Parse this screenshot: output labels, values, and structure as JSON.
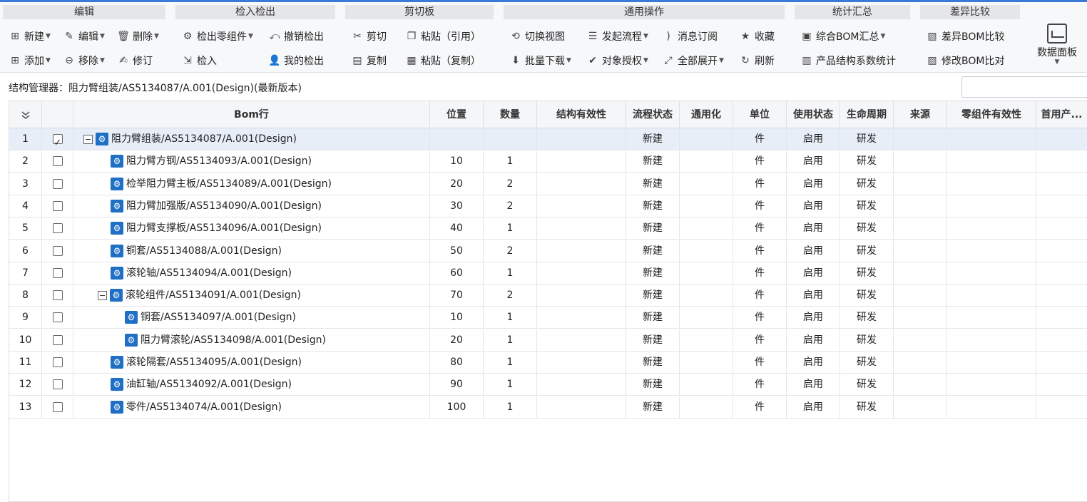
{
  "ribbon": {
    "groups": [
      {
        "title": "编辑"
      },
      {
        "title": "检入检出"
      },
      {
        "title": "剪切板"
      },
      {
        "title": "通用操作"
      },
      {
        "title": "统计汇总"
      },
      {
        "title": "差异比较"
      }
    ],
    "edit": {
      "new": "新建",
      "edit": "编辑",
      "delete": "删除",
      "add": "添加",
      "remove": "移除",
      "revise": "修订"
    },
    "checkinout": {
      "checkout_part": "检出零组件",
      "undo_checkout": "撤销检出",
      "checkin": "检入",
      "my_checkout": "我的检出"
    },
    "clipboard": {
      "cut": "剪切",
      "paste_ref": "粘贴（引用）",
      "copy": "复制",
      "paste_copy": "粘贴（复制）"
    },
    "common": {
      "switch_view": "切换视图",
      "start_flow": "发起流程",
      "subscribe": "消息订阅",
      "favorite": "收藏",
      "batch_download": "批量下载",
      "authorize": "对象授权",
      "expand_all": "全部展开",
      "refresh": "刷新"
    },
    "stats": {
      "bom_summary": "综合BOM汇总",
      "structure_stats": "产品结构系数统计"
    },
    "diff": {
      "bom_compare": "差异BOM比较",
      "modify_compare": "修改BOM比对"
    },
    "dashboard": "数据面板"
  },
  "path": {
    "text": "结构管理器：阻力臂组装/AS5134087/A.001(Design)(最新版本)"
  },
  "columns": [
    "Bom行",
    "位置",
    "数量",
    "结构有效性",
    "流程状态",
    "通用化",
    "单位",
    "使用状态",
    "生命周期",
    "来源",
    "零组件有效性",
    "首用产..."
  ],
  "rows": [
    {
      "num": "1",
      "checked": true,
      "level": 0,
      "toggle": true,
      "bom": "阻力臂组装/AS5134087/A.001(Design)",
      "pos": "",
      "qty": "",
      "flow": "新建",
      "unit": "件",
      "use": "启用",
      "life": "研发"
    },
    {
      "num": "2",
      "checked": false,
      "level": 1,
      "toggle": false,
      "bom": "阻力臂方钢/AS5134093/A.001(Design)",
      "pos": "10",
      "qty": "1",
      "flow": "新建",
      "unit": "件",
      "use": "启用",
      "life": "研发"
    },
    {
      "num": "3",
      "checked": false,
      "level": 1,
      "toggle": false,
      "bom": "检举阻力臂主板/AS5134089/A.001(Design)",
      "pos": "20",
      "qty": "2",
      "flow": "新建",
      "unit": "件",
      "use": "启用",
      "life": "研发"
    },
    {
      "num": "4",
      "checked": false,
      "level": 1,
      "toggle": false,
      "bom": "阻力臂加强版/AS5134090/A.001(Design)",
      "pos": "30",
      "qty": "2",
      "flow": "新建",
      "unit": "件",
      "use": "启用",
      "life": "研发"
    },
    {
      "num": "5",
      "checked": false,
      "level": 1,
      "toggle": false,
      "bom": "阻力臂支撑板/AS5134096/A.001(Design)",
      "pos": "40",
      "qty": "1",
      "flow": "新建",
      "unit": "件",
      "use": "启用",
      "life": "研发"
    },
    {
      "num": "6",
      "checked": false,
      "level": 1,
      "toggle": false,
      "bom": "铜套/AS5134088/A.001(Design)",
      "pos": "50",
      "qty": "2",
      "flow": "新建",
      "unit": "件",
      "use": "启用",
      "life": "研发"
    },
    {
      "num": "7",
      "checked": false,
      "level": 1,
      "toggle": false,
      "bom": "滚轮轴/AS5134094/A.001(Design)",
      "pos": "60",
      "qty": "1",
      "flow": "新建",
      "unit": "件",
      "use": "启用",
      "life": "研发"
    },
    {
      "num": "8",
      "checked": false,
      "level": 1,
      "toggle": true,
      "bom": "滚轮组件/AS5134091/A.001(Design)",
      "pos": "70",
      "qty": "2",
      "flow": "新建",
      "unit": "件",
      "use": "启用",
      "life": "研发"
    },
    {
      "num": "9",
      "checked": false,
      "level": 2,
      "toggle": false,
      "bom": "铜套/AS5134097/A.001(Design)",
      "pos": "10",
      "qty": "1",
      "flow": "新建",
      "unit": "件",
      "use": "启用",
      "life": "研发"
    },
    {
      "num": "10",
      "checked": false,
      "level": 2,
      "toggle": false,
      "bom": "阻力臂滚轮/AS5134098/A.001(Design)",
      "pos": "20",
      "qty": "1",
      "flow": "新建",
      "unit": "件",
      "use": "启用",
      "life": "研发"
    },
    {
      "num": "11",
      "checked": false,
      "level": 1,
      "toggle": false,
      "bom": "滚轮隔套/AS5134095/A.001(Design)",
      "pos": "80",
      "qty": "1",
      "flow": "新建",
      "unit": "件",
      "use": "启用",
      "life": "研发"
    },
    {
      "num": "12",
      "checked": false,
      "level": 1,
      "toggle": false,
      "bom": "油缸轴/AS5134092/A.001(Design)",
      "pos": "90",
      "qty": "1",
      "flow": "新建",
      "unit": "件",
      "use": "启用",
      "life": "研发"
    },
    {
      "num": "13",
      "checked": false,
      "level": 1,
      "toggle": false,
      "bom": "零件/AS5134074/A.001(Design)",
      "pos": "100",
      "qty": "1",
      "flow": "新建",
      "unit": "件",
      "use": "启用",
      "life": "研发"
    }
  ]
}
